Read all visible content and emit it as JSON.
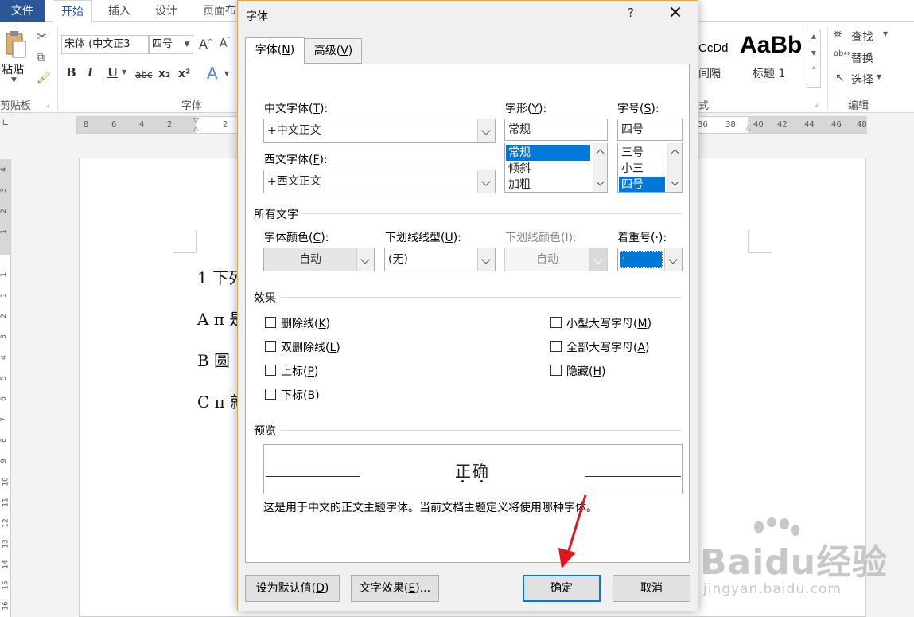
{
  "word": {
    "tabs": [
      "文件",
      "开始",
      "插入",
      "设计",
      "页面布"
    ],
    "clipboard": {
      "paste_label": "粘贴",
      "group_label": "剪贴板"
    },
    "font_group": {
      "font_name": "宋体 (中文正3",
      "font_size": "四号",
      "group_label": "字体",
      "format_buttons": [
        "B",
        "I",
        "U",
        "abc",
        "x₂",
        "x²",
        "A"
      ]
    },
    "styles": {
      "sample1": "CcDd",
      "sample1_label": "间隔",
      "sample2": "AaBb",
      "sample2_label": "标题 1",
      "group_label": "式"
    },
    "editing": {
      "find": "查找",
      "replace": "替换",
      "select": "选择",
      "group_label": "编辑"
    },
    "ruler_left": [
      "8",
      "6",
      "4",
      "2",
      "2"
    ],
    "ruler_right": [
      "36",
      "38",
      "40",
      "42",
      "44",
      "46",
      "48"
    ],
    "vruler": [
      "4",
      "3",
      "2",
      "1",
      "1",
      "1",
      "2",
      "3",
      "4",
      "5",
      "6",
      "7",
      "8",
      "9",
      "10",
      "11",
      "12",
      "13",
      "14",
      "15",
      "16",
      "17"
    ],
    "document_lines": [
      "1 下列",
      "A π 是",
      "B  圆",
      "C π 就"
    ],
    "watermark": {
      "brand": "Baidu经验",
      "url": "jingyan.baidu.com"
    }
  },
  "dialog": {
    "title": "字体",
    "help": "?",
    "close": "✕",
    "tabs": [
      {
        "label": "字体(N)",
        "text": "字体(",
        "key": "N",
        "tail": ")"
      },
      {
        "label": "高级(V)",
        "text": "高级(",
        "key": "V",
        "tail": ")"
      }
    ],
    "chinese_font": {
      "label_text": "中文字体(",
      "key": "T",
      "label_tail": "):",
      "value": "+中文正文"
    },
    "western_font": {
      "label_text": "西文字体(",
      "key": "F",
      "label_tail": "):",
      "value": "+西文正文"
    },
    "font_style": {
      "label_text": "字形(",
      "key": "Y",
      "label_tail": "):",
      "value": "常规",
      "options": [
        "常规",
        "倾斜",
        "加粗"
      ],
      "selected": "常规"
    },
    "font_size": {
      "label_text": "字号(",
      "key": "S",
      "label_tail": "):",
      "value": "四号",
      "options": [
        "三号",
        "小三",
        "四号"
      ],
      "selected": "四号"
    },
    "all_text_section": "所有文字",
    "font_color": {
      "label_text": "字体颜色(",
      "key": "C",
      "label_tail": "):",
      "value": "自动"
    },
    "underline_style": {
      "label_text": "下划线线型(",
      "key": "U",
      "label_tail": "):",
      "value": "(无)"
    },
    "underline_color": {
      "label": "下划线颜色(I):",
      "value": "自动"
    },
    "emphasis_mark": {
      "label": "着重号(·):",
      "value": "·"
    },
    "effects_section": "效果",
    "effects_left": [
      {
        "text": "删除线(",
        "key": "K",
        "tail": ")"
      },
      {
        "text": "双删除线(",
        "key": "L",
        "tail": ")"
      },
      {
        "text": "上标(",
        "key": "P",
        "tail": ")"
      },
      {
        "text": "下标(",
        "key": "B",
        "tail": ")"
      }
    ],
    "effects_right": [
      {
        "text": "小型大写字母(",
        "key": "M",
        "tail": ")"
      },
      {
        "text": "全部大写字母(",
        "key": "A",
        "tail": ")"
      },
      {
        "text": "隐藏(",
        "key": "H",
        "tail": ")"
      }
    ],
    "preview_section": "预览",
    "preview_text": "正确",
    "preview_note": "这是用于中文的正文主题字体。当前文档主题定义将使用哪种字体。",
    "buttons": {
      "set_default": {
        "text": "设为默认值(",
        "key": "D",
        "tail": ")"
      },
      "text_effects": {
        "text": "文字效果(",
        "key": "E",
        "tail": ")..."
      },
      "ok": "确定",
      "cancel": "取消"
    },
    "annotation_color": "#e0161b"
  }
}
